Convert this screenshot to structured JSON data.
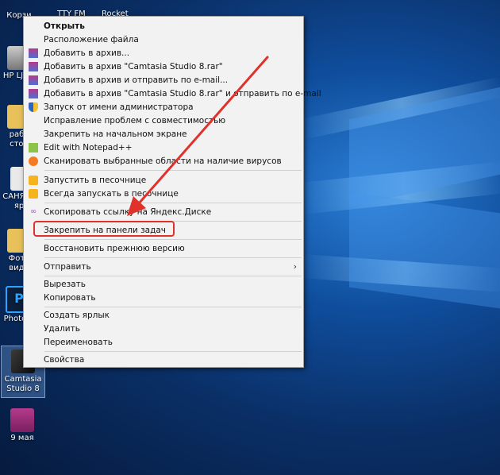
{
  "desktop": {
    "icons": [
      {
        "label": "Корзи"
      },
      {
        "label": "HP LJ Sc"
      },
      {
        "label": "рабо стол"
      },
      {
        "label": "САНЯ — яр"
      },
      {
        "label": "Фото виде"
      },
      {
        "label": "Photo C"
      },
      {
        "label": "Camtasia Studio 8"
      },
      {
        "label": "9 мая"
      }
    ],
    "top_labels": [
      "TTY FM",
      "Rocket"
    ]
  },
  "menu": {
    "items": [
      {
        "label": "Открыть",
        "icon": "none"
      },
      {
        "label": "Расположение файла",
        "icon": "none"
      },
      {
        "label": "Добавить в архив...",
        "icon": "winrar-icon"
      },
      {
        "label": "Добавить в архив \"Camtasia Studio 8.rar\"",
        "icon": "winrar-icon"
      },
      {
        "label": "Добавить в архив и отправить по e-mail...",
        "icon": "winrar-icon"
      },
      {
        "label": "Добавить в архив \"Camtasia Studio 8.rar\" и отправить по e-mail",
        "icon": "winrar-icon"
      },
      {
        "label": "Запуск от имени администратора",
        "icon": "uac-shield-icon"
      },
      {
        "label": "Исправление проблем с совместимостью",
        "icon": "none"
      },
      {
        "label": "Закрепить на начальном экране",
        "icon": "none"
      },
      {
        "label": "Edit with Notepad++",
        "icon": "notepad-icon"
      },
      {
        "label": "Сканировать выбранные области на наличие вирусов",
        "icon": "avast-icon"
      },
      {
        "label": "Запустить в песочнице",
        "icon": "sandbox-icon"
      },
      {
        "label": "Всегда запускать в песочнице",
        "icon": "sandbox-icon"
      },
      {
        "label": "Скопировать ссылку на Яндекс.Диске",
        "icon": "yandex-disk-icon"
      },
      {
        "label": "Закрепить на панели задач",
        "icon": "none"
      },
      {
        "label": "Восстановить прежнюю версию",
        "icon": "none"
      },
      {
        "label": "Отправить",
        "icon": "none"
      },
      {
        "label": "Вырезать",
        "icon": "none"
      },
      {
        "label": "Копировать",
        "icon": "none"
      },
      {
        "label": "Создать ярлык",
        "icon": "none"
      },
      {
        "label": "Удалить",
        "icon": "none"
      },
      {
        "label": "Переименовать",
        "icon": "none"
      },
      {
        "label": "Свойства",
        "icon": "none"
      }
    ]
  },
  "colors": {
    "highlight": "#e0322b",
    "arrow": "#e0322b",
    "menu_bg": "#f2f2f2"
  }
}
